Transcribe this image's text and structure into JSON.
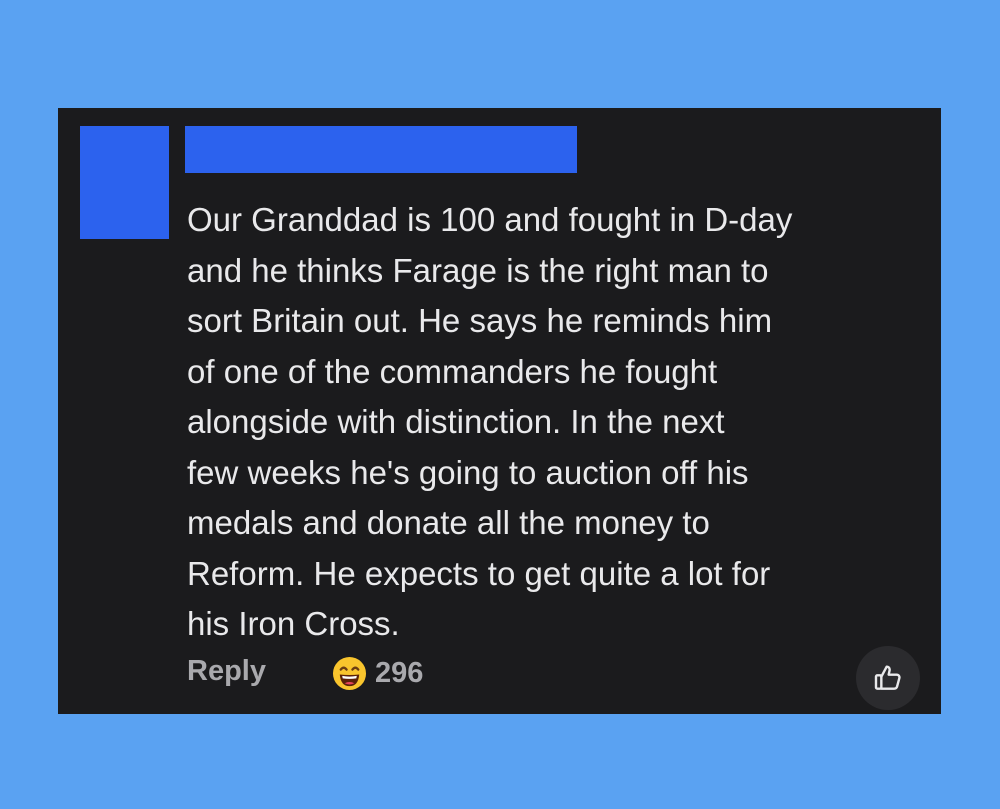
{
  "comment": {
    "text": "Our Granddad is 100 and fought in D-day\nand he thinks Farage is the right man to\nsort Britain out.  He says he reminds him\nof one of the commanders he fought\nalongside with distinction.  In the next\nfew weeks he's going to auction off his\nmedals and donate all the money to\nReform. He expects to get quite a lot for\nhis Iron Cross.",
    "author_redacted": true,
    "avatar_redacted": true
  },
  "actions": {
    "reply_label": "Reply",
    "reaction_icon": "laughing-emoji-icon",
    "reaction_count": "296",
    "like_icon": "thumbs-up-icon"
  },
  "colors": {
    "page_background": "#5aa2f2",
    "card_background": "#1b1b1d",
    "redaction_block": "#2c62ee",
    "text": "#e9e9eb",
    "muted_text": "#a9a9ad"
  }
}
